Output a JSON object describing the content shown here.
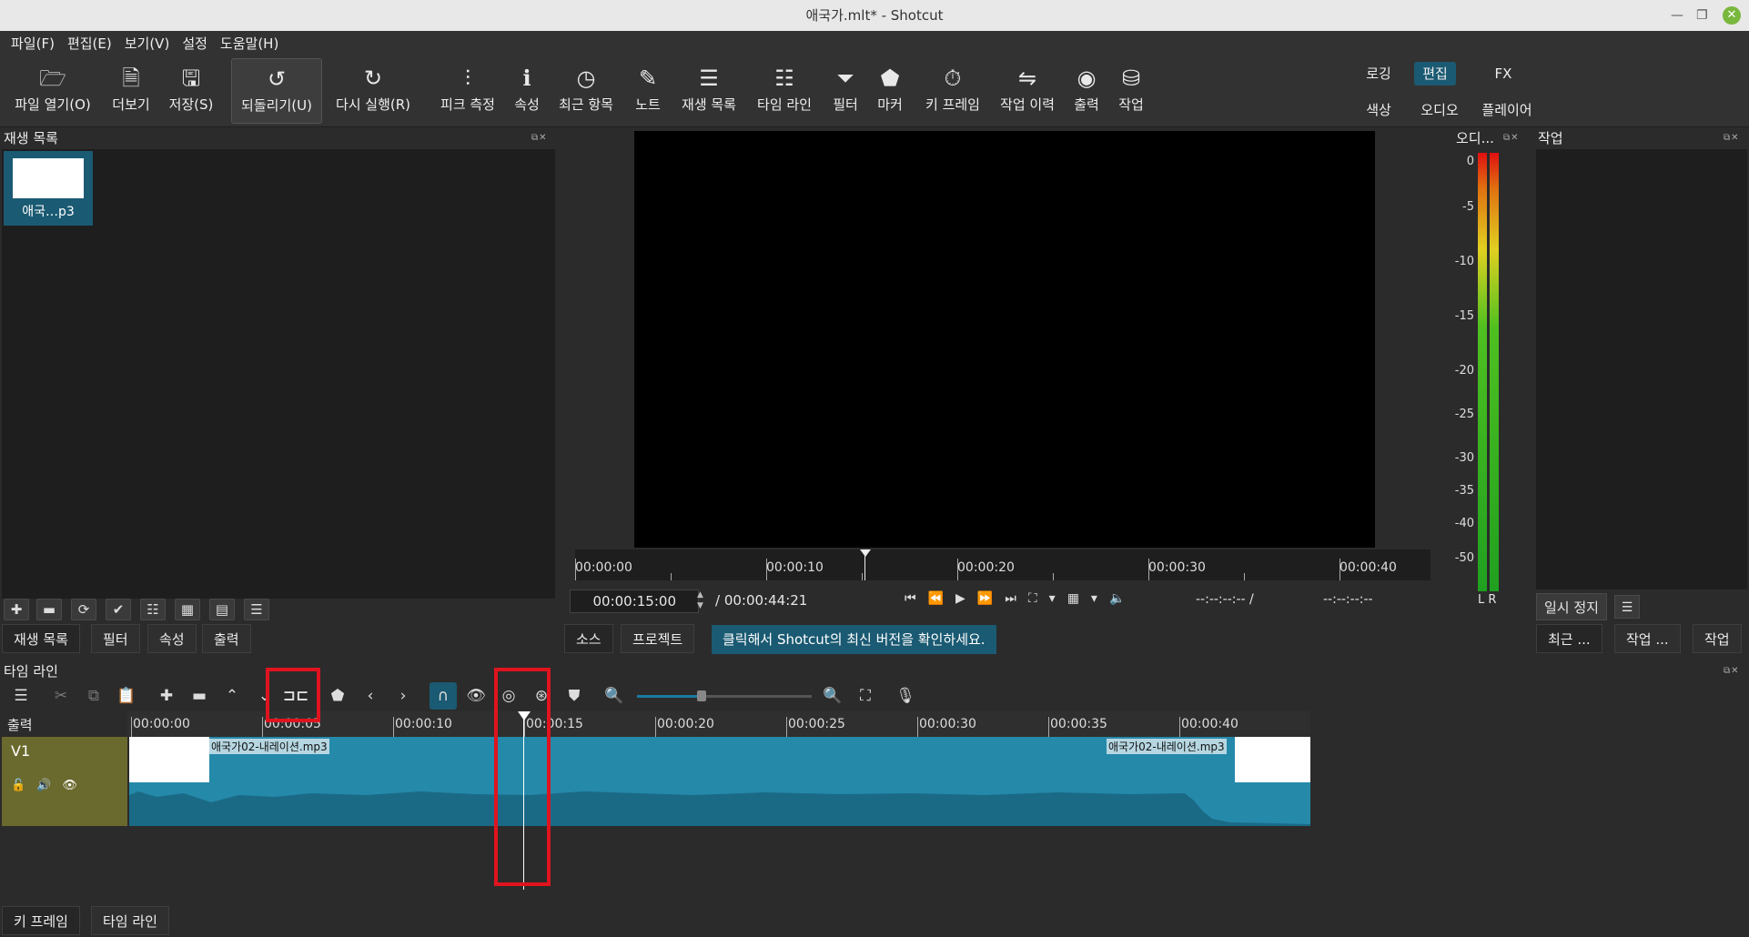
{
  "window": {
    "title": "애국가.mlt* - Shotcut"
  },
  "menu": [
    "파일(F)",
    "편집(E)",
    "보기(V)",
    "설정",
    "도움말(H)"
  ],
  "toolbar": {
    "open": "파일 열기(O)",
    "more": "더보기",
    "save": "저장(S)",
    "undo": "되돌리기(U)",
    "redo": "다시 실행(R)",
    "peak": "피크 측정",
    "properties": "속성",
    "recent": "최근 항목",
    "notes": "노트",
    "playlist": "재생 목록",
    "timeline": "타임 라인",
    "filters": "필터",
    "markers": "마커",
    "keyframes": "키 프레임",
    "history": "작업 이력",
    "export": "출력",
    "jobs": "작업"
  },
  "layouts": {
    "logging": "로깅",
    "editing": "편집",
    "fx": "FX",
    "color": "색상",
    "audio": "오디오",
    "player": "플레이어"
  },
  "playlist": {
    "header": "재생 목록",
    "item_label": "애국…p3",
    "tabs": [
      "재생 목록",
      "필터",
      "속성",
      "출력"
    ]
  },
  "player": {
    "ruler": [
      "00:00:00",
      "00:00:10",
      "00:00:20",
      "00:00:30",
      "00:00:40"
    ],
    "current_time": "00:00:15:00",
    "total_time": "/ 00:00:44:21",
    "in_point": "--:--:--:-- /",
    "out_point": "--:--:--:--",
    "tabs": [
      "소스",
      "프로젝트"
    ],
    "update_notice": "클릭해서 Shotcut의 최신 버전을 확인하세요."
  },
  "audio_meter": {
    "header": "오디...",
    "scale": [
      "0",
      "-5",
      "-10",
      "-15",
      "-20",
      "-25",
      "-30",
      "-35",
      "-40",
      "-50"
    ],
    "channels": "L R"
  },
  "jobs": {
    "header": "작업",
    "pause_button": "일시 정지",
    "tabs": [
      "최근 ...",
      "작업 ...",
      "작업"
    ]
  },
  "timeline": {
    "header": "타임 라인",
    "output_label": "출력",
    "track_name": "V1",
    "ruler": [
      "00:00:00",
      "00:00:05",
      "00:00:10",
      "00:00:15",
      "00:00:20",
      "00:00:25",
      "00:00:30",
      "00:00:35",
      "00:00:40"
    ],
    "clip_name_left": "애국가02-내레이션.mp3",
    "clip_name_right": "애국가02-내레이션.mp3"
  },
  "bottom_tabs": [
    "키 프레임",
    "타임 라인"
  ],
  "colors": {
    "accent": "#1a5a72",
    "clip": "#2589aa",
    "track_head": "#6b6a2e",
    "highlight": "#e0141e"
  }
}
